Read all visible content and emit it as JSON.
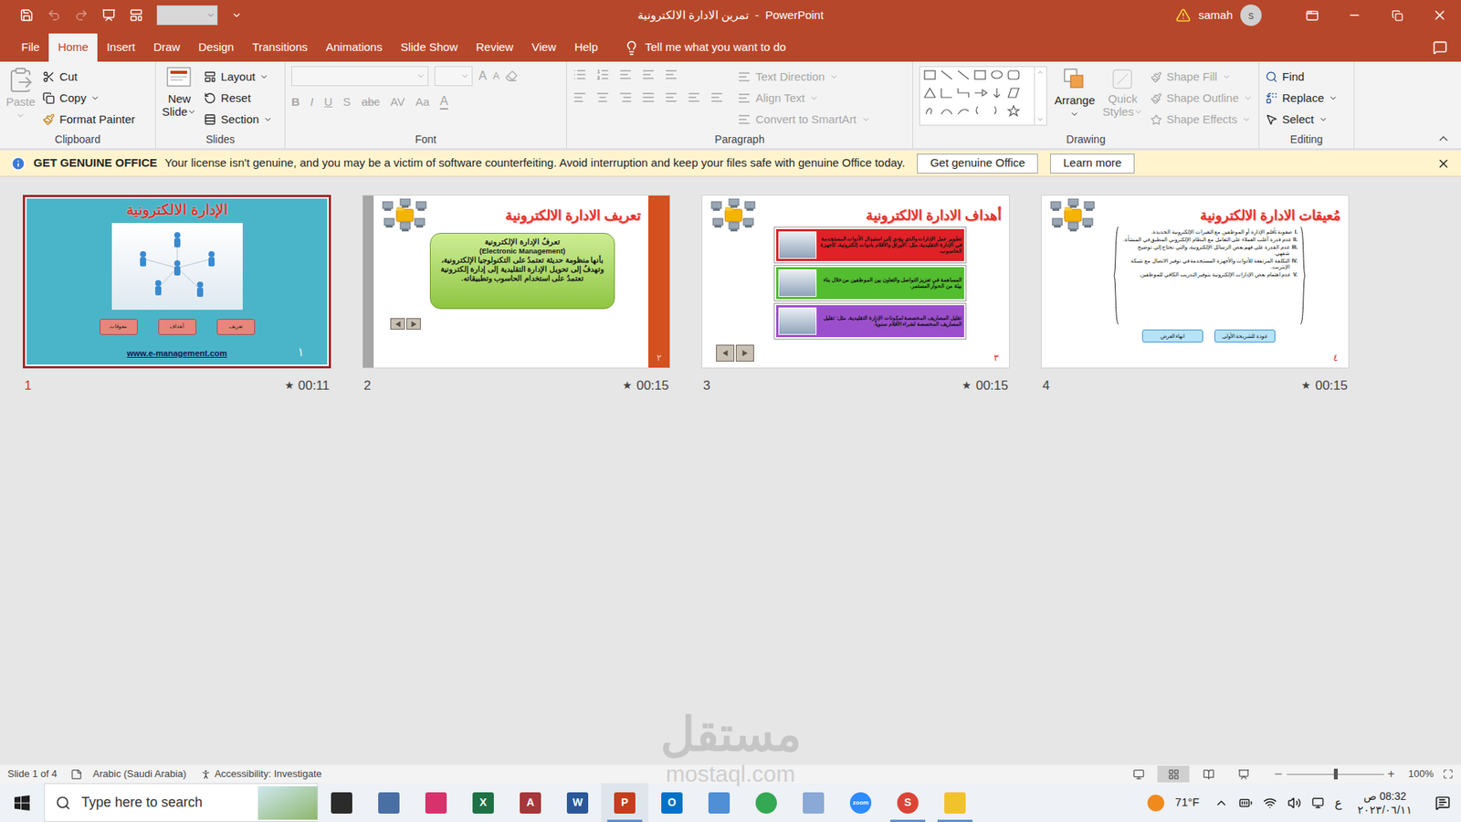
{
  "window": {
    "title": "تمرين الادارة الالكترونية  -  PowerPoint",
    "user": "samah",
    "avatar": "s"
  },
  "menu_tabs": [
    {
      "label": "File",
      "selected": false
    },
    {
      "label": "Home",
      "selected": true
    },
    {
      "label": "Insert",
      "selected": false
    },
    {
      "label": "Draw",
      "selected": false
    },
    {
      "label": "Design",
      "selected": false
    },
    {
      "label": "Transitions",
      "selected": false
    },
    {
      "label": "Animations",
      "selected": false
    },
    {
      "label": "Slide Show",
      "selected": false
    },
    {
      "label": "Review",
      "selected": false
    },
    {
      "label": "View",
      "selected": false
    },
    {
      "label": "Help",
      "selected": false
    }
  ],
  "tell_me": "Tell me what you want to do",
  "clipboard": {
    "label": "Clipboard",
    "paste": "Paste",
    "cut": "Cut",
    "copy": "Copy",
    "format_painter": "Format Painter",
    "paste_disabled": true
  },
  "slides_group": {
    "label": "Slides",
    "new": "New",
    "slide": "Slide",
    "layout": "Layout",
    "reset": "Reset",
    "section": "Section"
  },
  "font": {
    "label": "Font",
    "size_buttons": [
      "A",
      "A"
    ],
    "buttons": [
      "B",
      "I",
      "U",
      "S",
      "abc",
      "AV",
      "Aa"
    ],
    "color_button": "A",
    "disabled": true
  },
  "paragraph": {
    "label": "Paragraph",
    "text_direction": "Text Direction",
    "align_text": "Align Text",
    "smartart": "Convert to SmartArt",
    "disabled": true
  },
  "drawing": {
    "label": "Drawing",
    "arrange": "Arrange",
    "quick": "Quick",
    "styles": "Styles",
    "shape_fill": "Shape Fill",
    "shape_outline": "Shape Outline",
    "shape_effects": "Shape Effects",
    "styles_disabled": true
  },
  "editing": {
    "label": "Editing",
    "find": "Find",
    "replace": "Replace",
    "select": "Select"
  },
  "message_bar": {
    "title": "GET GENUINE OFFICE",
    "text": "Your license isn't genuine, and you may be a victim of software counterfeiting. Avoid interruption and keep your files safe with genuine Office today.",
    "buttons": [
      "Get genuine Office",
      "Learn more"
    ]
  },
  "slides": [
    {
      "kind": "cover",
      "number": "1",
      "time": "00:11",
      "star": "★",
      "selected": true,
      "title": "الإدارة الالكترونية",
      "buttons": [
        "معوقات",
        "أهداف",
        "تعريف"
      ],
      "url": "www.e-management.com",
      "page": "١"
    },
    {
      "kind": "definition",
      "number": "2",
      "time": "00:15",
      "star": "★",
      "selected": false,
      "title": "تعريف الادارة الالكترونية",
      "body": [
        "تعرفُ الإدارة الإلكترونية",
        "(Electronic Management)",
        "بأنها منظومة حديثة تعتمدُ على التكنولوجيا الإلكترونية، وتهدفُ إلى تحويل الإدارة التقليدية إلى إدارة إلكترونية تعتمدُ على استخدام الحاسوب وتطبيقاته."
      ],
      "page": "٢"
    },
    {
      "kind": "goals",
      "number": "3",
      "time": "00:15",
      "star": "★",
      "selected": false,
      "title": "أهداف الادارة الالكترونية",
      "items": [
        {
          "text": "تطوير عمل الإدارات والذي يؤدي إلى استبدال الأدوات المستخدمة في الإدارة التقليدية، مثل: الأوراق والأقلام بأدوات إلكترونية، كأجهزة الحاسوب.",
          "color": "#e02128"
        },
        {
          "text": "المساهمة في تعزيز التواصل والتعاون بين الموظفين من خلال بناء بيئة من الحوار المستمر.",
          "color": "#52bd2f"
        },
        {
          "text": "تقليل المصاريف المخصصة لمكونات الإدارة التقليدية، مثل: تقليل المصاريف المخصصة لشراء الأقلام سنوياً.",
          "color": "#9c4fcc"
        }
      ],
      "page": "٣"
    },
    {
      "kind": "obstacles",
      "number": "4",
      "time": "00:15",
      "star": "★",
      "selected": false,
      "title": "مُعيقات الادارة الالكترونية",
      "items": [
        {
          "num": "I.",
          "text": "صعوبة تأقلم الإدارة أو الموظفين مع التغيرات الإلكترونية الجديدة."
        },
        {
          "num": "II.",
          "text": "عدم قدرة أغلب العملاء على التعامل مع النظام الإلكتروني المطبق في المنشأة."
        },
        {
          "num": "III.",
          "text": "عدم القدرة على فهم بعض الرسائل الإلكترونية، والتي تحتاج إلى توضيح شفهي."
        },
        {
          "num": "IV.",
          "text": "التكلفة المرتفعة للأدوات والأجهزة المستخدمة في توفير الاتصال مع شبكة الإنترنت."
        },
        {
          "num": "V.",
          "text": "عدم اهتمام بعض الإدارات الإلكترونية بتوفير التدريب الكافي للموظفين."
        }
      ],
      "buttons": [
        "انهاء العرض",
        "عودة للشريحة الأولى"
      ],
      "page": "٤"
    }
  ],
  "status_bar": {
    "slide": "Slide 1 of 4",
    "language": "Arabic (Saudi Arabia)",
    "accessibility": "Accessibility: Investigate",
    "views": [
      {
        "kind": "normal",
        "selected": false
      },
      {
        "kind": "sorter",
        "selected": true
      },
      {
        "kind": "reading",
        "selected": false
      },
      {
        "kind": "show",
        "selected": false
      }
    ],
    "zoom": "100%",
    "zoom_level": 0.5
  },
  "taskbar": {
    "search": "Type here to search",
    "apps": [
      {
        "kind": "task-view",
        "label": "",
        "color": "#2b2b2b",
        "active": false
      },
      {
        "kind": "calculator",
        "label": "",
        "color": "#4a6fa5",
        "active": false
      },
      {
        "kind": "snip",
        "label": "",
        "color": "#d6336c",
        "active": false
      },
      {
        "kind": "excel",
        "label": "X",
        "color": "#1e7145",
        "active": false
      },
      {
        "kind": "access",
        "label": "A",
        "color": "#a4373a",
        "active": false
      },
      {
        "kind": "word",
        "label": "W",
        "color": "#2b579a",
        "active": false
      },
      {
        "kind": "powerpoint",
        "label": "P",
        "color": "#c43e1c",
        "active": true
      },
      {
        "kind": "outlook",
        "label": "O",
        "color": "#0072c6",
        "active": false
      },
      {
        "kind": "network",
        "label": "",
        "color": "#4f8fd6",
        "active": false
      },
      {
        "kind": "chrome",
        "label": "",
        "color": "#34a853",
        "active": false
      },
      {
        "kind": "paint",
        "label": "",
        "color": "#8aa9d6",
        "active": false
      },
      {
        "kind": "zoom",
        "label": "zoom",
        "color": "#2d8cff",
        "active": false
      },
      {
        "kind": "chrome-profile",
        "label": "S",
        "color": "#db4437",
        "active": true
      },
      {
        "kind": "explorer",
        "label": "",
        "color": "#f2c12e",
        "active": true
      }
    ],
    "weather": "71°F",
    "language": "ع",
    "time": "08:32 ص",
    "date": "٢٠٢٣/٠٦/١١"
  },
  "watermark": {
    "word": "مستقل",
    "domain": "mostaql.com"
  }
}
